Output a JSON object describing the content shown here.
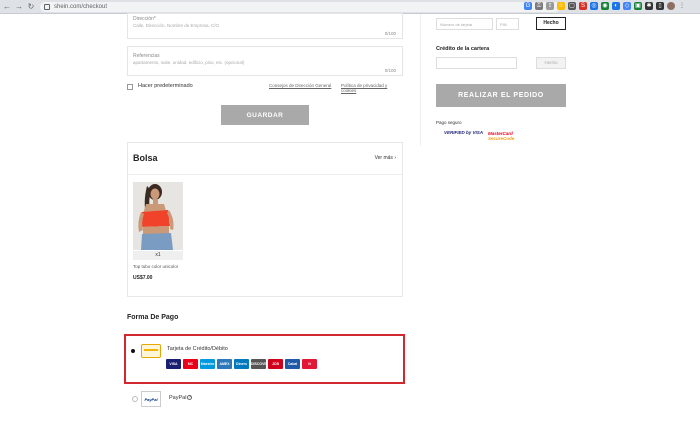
{
  "browser": {
    "url": "shein.com/checkout"
  },
  "address_form": {
    "direccion": {
      "label": "Dirección*",
      "placeholder": "Calle, Dirección, Nombre de Empresa, C/O",
      "count": "0/100"
    },
    "referencias": {
      "label": "Referencias",
      "placeholder": "apartamento, suite, unidad, edificio, piso, etc. (opcional)",
      "count": "0/100"
    },
    "default_label": "Hacer predeterminado",
    "link_consejos": "Consejos de Dirección General",
    "link_privacidad": "Política de privacidad y cookies",
    "save_label": "GUARDAR"
  },
  "bag": {
    "title": "Bolsa",
    "see_more": "Ver más",
    "item": {
      "qty": "x1",
      "name": "Top tubo color unicolor",
      "price": "US$7.00"
    }
  },
  "payment": {
    "title": "Forma De Pago",
    "card_label": "Tarjeta de Crédito/Débito",
    "brands": [
      {
        "name": "VISA",
        "color": "#1a1f71"
      },
      {
        "name": "MC",
        "color": "#eb001b"
      },
      {
        "name": "Maestro",
        "color": "#0099df"
      },
      {
        "name": "AMEX",
        "color": "#2e77bb"
      },
      {
        "name": "Diners",
        "color": "#0079be"
      },
      {
        "name": "DISCOVER",
        "color": "#555555"
      },
      {
        "name": "JCB",
        "color": "#d0021b"
      },
      {
        "name": "Cabal",
        "color": "#1e5aa8"
      },
      {
        "name": "N",
        "color": "#e31837"
      }
    ],
    "paypal_logo": "PayPal",
    "paypal_label": "PayPal"
  },
  "sidebar": {
    "gift_card_placeholder": "Número de tarjeta",
    "pin_placeholder": "PIN",
    "done_label": "Hecho",
    "wallet_title": "Crédito de la cartera",
    "wallet_done_label": "Hecho",
    "order_label": "REALIZAR EL PEDIDO",
    "secure_title": "Pago seguro",
    "vbv_text": "VERIFIED by VISA",
    "msc_text_1": "MasterCard",
    "msc_text_2": "SecureCode"
  }
}
